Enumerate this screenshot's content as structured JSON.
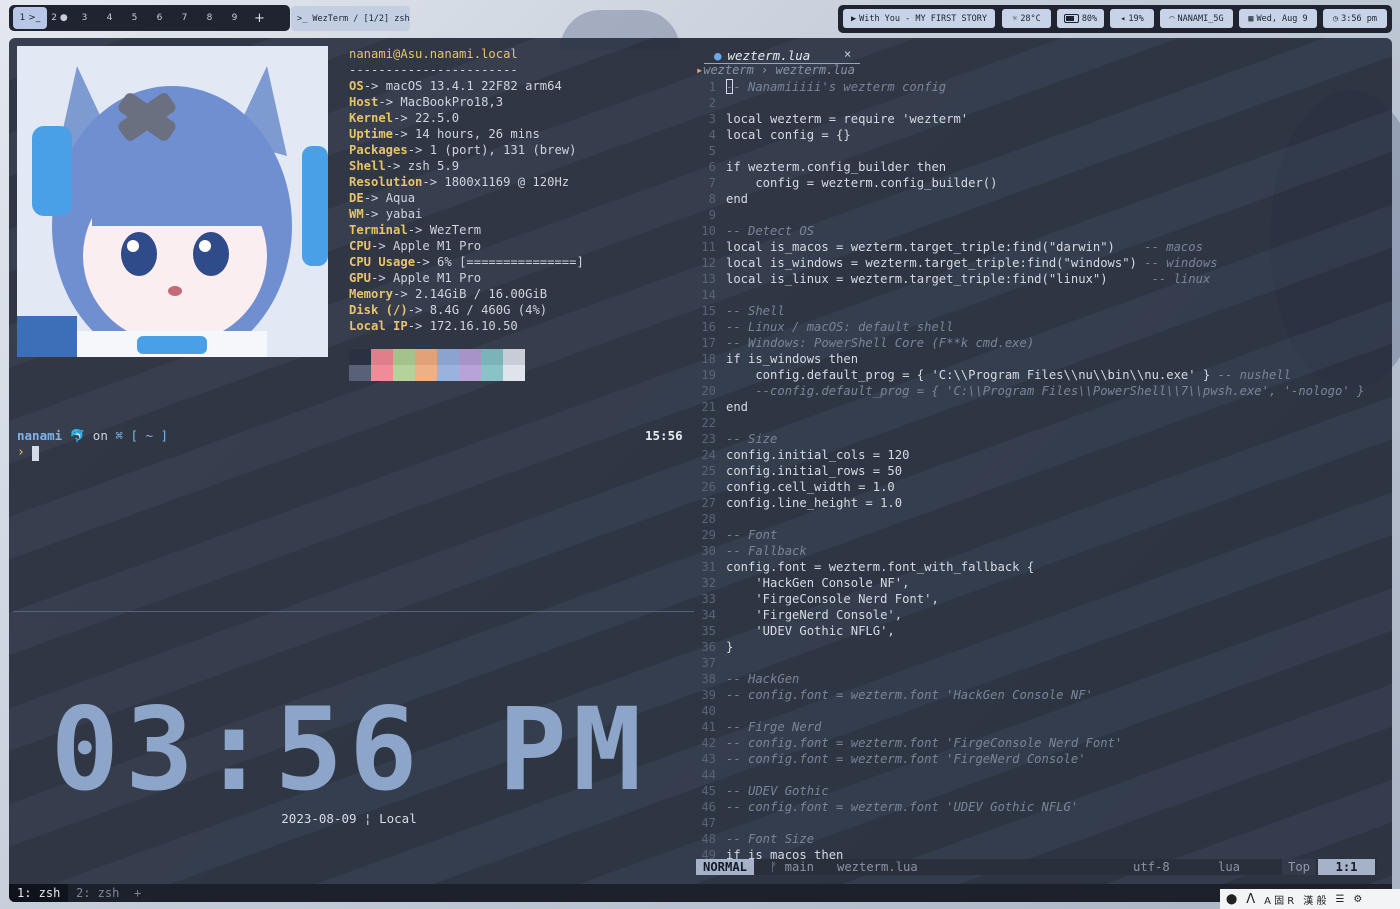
{
  "workspaces": [
    {
      "label": "1 >_",
      "active": true
    },
    {
      "label": "2 ●",
      "active": false
    },
    {
      "label": "3",
      "active": false
    },
    {
      "label": "4",
      "active": false
    },
    {
      "label": "5",
      "active": false
    },
    {
      "label": "6",
      "active": false
    },
    {
      "label": "7",
      "active": false
    },
    {
      "label": "8",
      "active": false
    },
    {
      "label": "9",
      "active": false
    }
  ],
  "workspace_add": "+",
  "window_title": ">_ WezTerm / [1/2] zsh",
  "status": {
    "music": "With You - MY FIRST STORY",
    "temp": "28°C",
    "battery": "80%",
    "volume": "19%",
    "wifi": "NANAMI_5G",
    "date": "Wed, Aug 9",
    "time": "3:56 pm"
  },
  "neofetch": {
    "header": "nanami@Asu.nanami.local",
    "separator": "-----------------------",
    "rows": [
      {
        "key": "OS",
        "val": "-> macOS 13.4.1 22F82 arm64"
      },
      {
        "key": "Host",
        "val": "-> MacBookPro18,3"
      },
      {
        "key": "Kernel",
        "val": "-> 22.5.0"
      },
      {
        "key": "Uptime",
        "val": "-> 14 hours, 26 mins"
      },
      {
        "key": "Packages",
        "val": "-> 1 (port), 131 (brew)"
      },
      {
        "key": "Shell",
        "val": "-> zsh 5.9"
      },
      {
        "key": "Resolution",
        "val": "-> 1800x1169 @ 120Hz"
      },
      {
        "key": "DE",
        "val": "-> Aqua"
      },
      {
        "key": "WM",
        "val": "-> yabai"
      },
      {
        "key": "Terminal",
        "val": "-> WezTerm"
      },
      {
        "key": "CPU",
        "val": "-> Apple M1 Pro"
      },
      {
        "key": "CPU Usage",
        "val": "-> 6% [===============]"
      },
      {
        "key": "GPU",
        "val": "-> Apple M1 Pro"
      },
      {
        "key": "Memory",
        "val": "-> 2.14GiB / 16.00GiB"
      },
      {
        "key": "Disk (/)",
        "val": "-> 8.4G / 460G (4%)"
      },
      {
        "key": "Local IP",
        "val": "-> 172.16.10.50"
      }
    ],
    "swatches_top": [
      "#2b3142",
      "#e07e8c",
      "#a6c28c",
      "#e0a276",
      "#8aa3cf",
      "#a893c7",
      "#7ab3b8",
      "#c8ccd6"
    ],
    "swatches_bottom": [
      "#596178",
      "#ef8c98",
      "#b6d29b",
      "#eeb185",
      "#9ab3de",
      "#b8a3d6",
      "#89c3c8",
      "#dfe3ec"
    ]
  },
  "prompt": {
    "user": "nanami",
    "on": "on",
    "dir": "[ ~ ]",
    "time": "15:56",
    "caret": "›"
  },
  "clock": {
    "time": "03:56 PM",
    "date": "2023-08-09 ¦ Local"
  },
  "editor": {
    "tab": "wezterm.lua",
    "breadcrumb": "wezterm › wezterm.lua",
    "lines": [
      {
        "n": "1",
        "t": "-- Nanamiiiii's wezterm config",
        "c": true
      },
      {
        "n": "2",
        "t": ""
      },
      {
        "n": "3",
        "t": "local wezterm = require 'wezterm'"
      },
      {
        "n": "4",
        "t": "local config = {}"
      },
      {
        "n": "5",
        "t": ""
      },
      {
        "n": "6",
        "t": "if wezterm.config_builder then"
      },
      {
        "n": "7",
        "t": "    config = wezterm.config_builder()"
      },
      {
        "n": "8",
        "t": "end"
      },
      {
        "n": "9",
        "t": ""
      },
      {
        "n": "10",
        "t": "-- Detect OS",
        "c": true
      },
      {
        "n": "11",
        "t": "local is_macos = wezterm.target_triple:find(\"darwin\")",
        "tc": "    -- macos"
      },
      {
        "n": "12",
        "t": "local is_windows = wezterm.target_triple:find(\"windows\")",
        "tc": " -- windows"
      },
      {
        "n": "13",
        "t": "local is_linux = wezterm.target_triple:find(\"linux\")",
        "tc": "      -- linux"
      },
      {
        "n": "14",
        "t": ""
      },
      {
        "n": "15",
        "t": "-- Shell",
        "c": true
      },
      {
        "n": "16",
        "t": "-- Linux / macOS: default shell",
        "c": true
      },
      {
        "n": "17",
        "t": "-- Windows: PowerShell Core (F**k cmd.exe)",
        "c": true
      },
      {
        "n": "18",
        "t": "if is_windows then"
      },
      {
        "n": "19",
        "t": "    config.default_prog = { 'C:\\\\Program Files\\\\nu\\\\bin\\\\nu.exe' }",
        "tc": " -- nushell"
      },
      {
        "n": "20",
        "t": "    --config.default_prog = { 'C:\\\\Program Files\\\\PowerShell\\\\7\\\\pwsh.exe', '-nologo' }",
        "c": true
      },
      {
        "n": "21",
        "t": "end"
      },
      {
        "n": "22",
        "t": ""
      },
      {
        "n": "23",
        "t": "-- Size",
        "c": true
      },
      {
        "n": "24",
        "t": "config.initial_cols = 120"
      },
      {
        "n": "25",
        "t": "config.initial_rows = 50"
      },
      {
        "n": "26",
        "t": "config.cell_width = 1.0"
      },
      {
        "n": "27",
        "t": "config.line_height = 1.0"
      },
      {
        "n": "28",
        "t": ""
      },
      {
        "n": "29",
        "t": "-- Font",
        "c": true
      },
      {
        "n": "30",
        "t": "-- Fallback",
        "c": true
      },
      {
        "n": "31",
        "t": "config.font = wezterm.font_with_fallback {"
      },
      {
        "n": "32",
        "t": "    'HackGen Console NF',"
      },
      {
        "n": "33",
        "t": "    'FirgeConsole Nerd Font',"
      },
      {
        "n": "34",
        "t": "    'FirgeNerd Console',"
      },
      {
        "n": "35",
        "t": "    'UDEV Gothic NFLG',"
      },
      {
        "n": "36",
        "t": "}"
      },
      {
        "n": "37",
        "t": ""
      },
      {
        "n": "38",
        "t": "-- HackGen",
        "c": true
      },
      {
        "n": "39",
        "t": "-- config.font = wezterm.font 'HackGen Console NF'",
        "c": true
      },
      {
        "n": "40",
        "t": ""
      },
      {
        "n": "41",
        "t": "-- Firge Nerd",
        "c": true
      },
      {
        "n": "42",
        "t": "-- config.font = wezterm.font 'FirgeConsole Nerd Font'",
        "c": true
      },
      {
        "n": "43",
        "t": "-- config.font = wezterm.font 'FirgeNerd Console'",
        "c": true
      },
      {
        "n": "44",
        "t": ""
      },
      {
        "n": "45",
        "t": "-- UDEV Gothic",
        "c": true
      },
      {
        "n": "46",
        "t": "-- config.font = wezterm.font 'UDEV Gothic NFLG'",
        "c": true
      },
      {
        "n": "47",
        "t": ""
      },
      {
        "n": "48",
        "t": "-- Font Size",
        "c": true
      },
      {
        "n": "49",
        "t": "if is_macos then"
      }
    ],
    "statusline": {
      "mode": "NORMAL",
      "branch": "ᚠ main",
      "file": "wezterm.lua",
      "encoding": "utf-8",
      "lang": "lua",
      "scroll": "Top",
      "position": "1:1"
    }
  },
  "tmux": {
    "tab1": "1: zsh",
    "tab2": "2: zsh",
    "add": "+"
  },
  "tray": {
    "ime": "A 固 R",
    "ime2": "漢 般"
  }
}
